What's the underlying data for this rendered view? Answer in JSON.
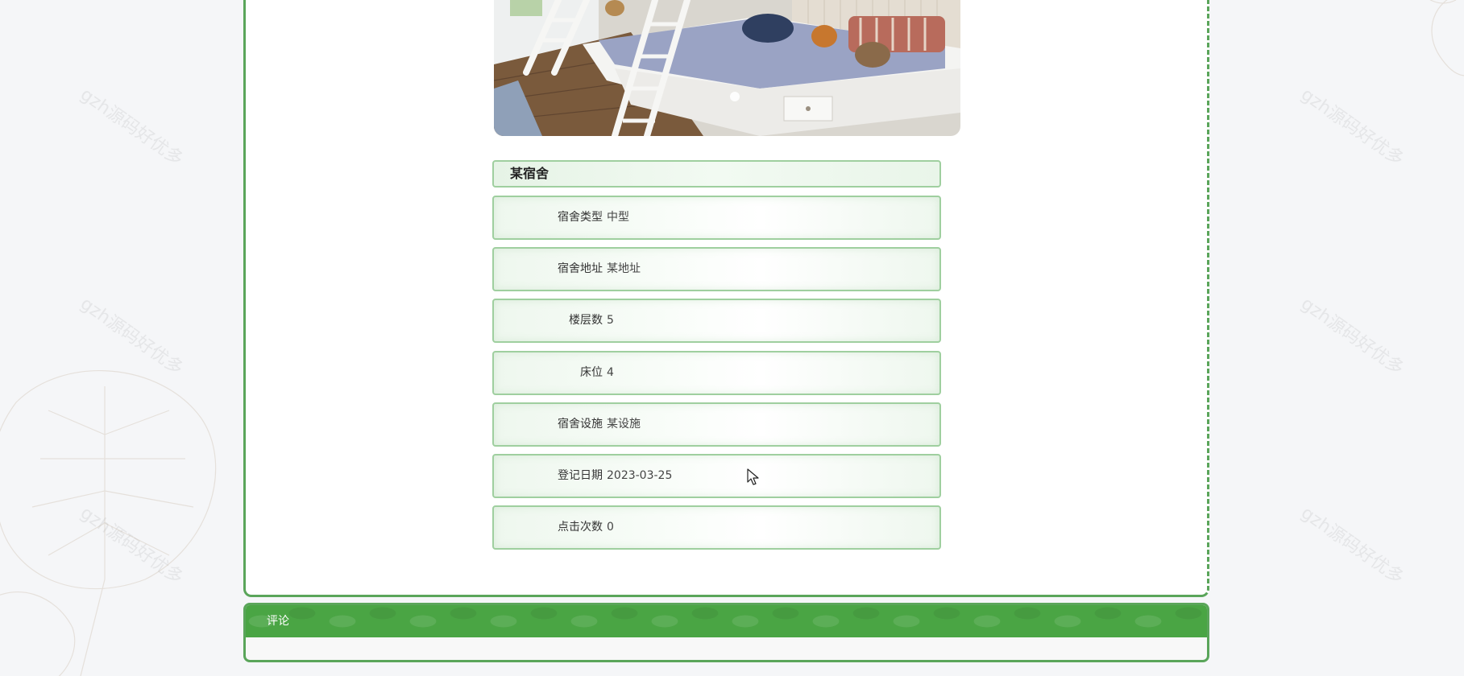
{
  "watermark_text": "gzh源码好优多",
  "dorm": {
    "name": "某宿舍",
    "fields": [
      {
        "label": "宿舍类型",
        "value": "中型"
      },
      {
        "label": "宿舍地址",
        "value": "某地址"
      },
      {
        "label": "楼层数",
        "value": "5"
      },
      {
        "label": "床位",
        "value": "4"
      },
      {
        "label": "宿舍设施",
        "value": "某设施"
      },
      {
        "label": "登记日期",
        "value": "2023-03-25"
      },
      {
        "label": "点击次数",
        "value": "0"
      }
    ]
  },
  "comment": {
    "title": "评论"
  },
  "colors": {
    "accent_green": "#4aa544",
    "border_green": "#5aa55a",
    "row_border": "#9fcf9f"
  }
}
